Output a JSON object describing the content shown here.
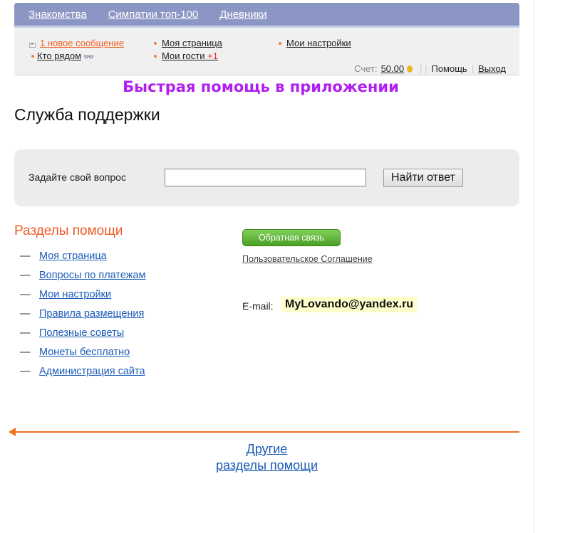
{
  "nav": {
    "items": [
      "Знакомства",
      "Симпатии топ-100",
      "Дневники"
    ]
  },
  "subnav": {
    "messages": "1 новое сообщение",
    "nearby": "Кто рядом",
    "my_page": "Моя страница",
    "my_guests": "Мои гости",
    "guests_count": "+1",
    "my_settings": "Мои настройки",
    "account_label": "Счет:",
    "balance": "50.00",
    "help": "Помощь",
    "logout": "Выход"
  },
  "banner": "Быстрая помощь в приложении",
  "page_title": "Служба поддержки",
  "search": {
    "label": "Задайте свой вопрос",
    "value": "",
    "button": "Найти ответ"
  },
  "sections": {
    "title": "Разделы помощи",
    "dash": "—",
    "items": [
      "Моя страница",
      "Вопросы по платежам",
      "Мои настройки",
      "Правила размещения",
      "Полезные советы",
      "Монеты бесплатно",
      "Администрация сайта"
    ]
  },
  "feedback_button": "Обратная связь",
  "agreement_link": "Пользовательское Соглашение",
  "email": {
    "label": "E-mail:",
    "value": "MyLovando@yandex.ru"
  },
  "other_sections": {
    "line1": "Другие",
    "line2": "разделы помощи"
  },
  "colors": {
    "nav_bg": "#8b96c4",
    "banner": "#b21ef0",
    "sections_title": "#f05a28",
    "link": "#1a5bb8",
    "arrow": "#f07020",
    "feedback_green": "#5cb030"
  }
}
